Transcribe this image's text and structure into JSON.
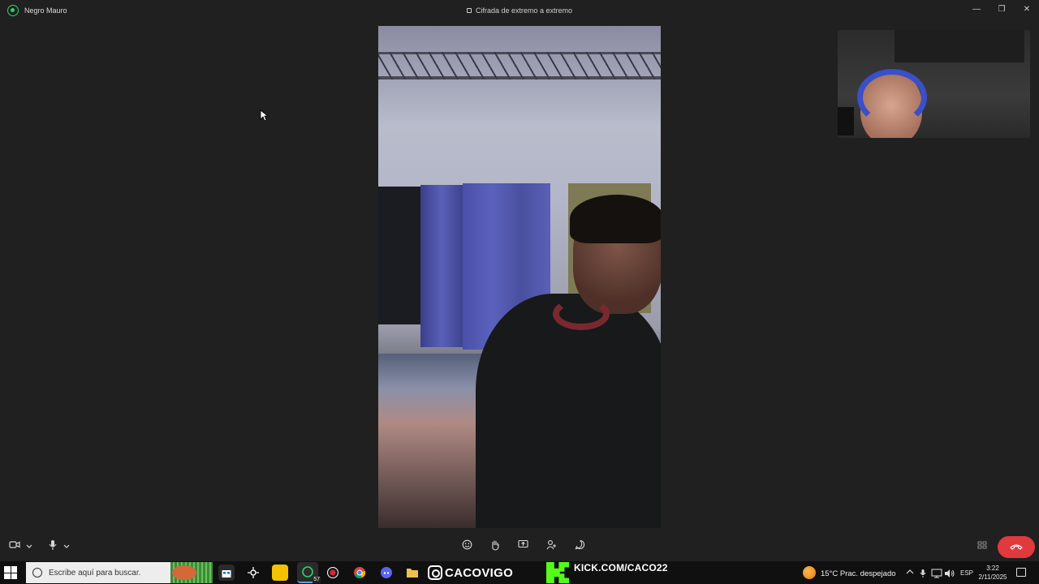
{
  "titlebar": {
    "contact_name": "Negro Mauro",
    "encryption_text": "Cifrada de extremo a extremo",
    "minimize": "—",
    "restore": "❐",
    "close": "✕"
  },
  "call_controls": {
    "video_icon": "video-camera-icon",
    "mic_icon": "microphone-icon",
    "center_icons": [
      "emoji-icon",
      "raise-hand-icon",
      "screen-share-icon",
      "add-person-icon",
      "chat-icon"
    ],
    "layout_icon": "grid-layout-icon",
    "end_call_icon": "hang-up-icon"
  },
  "taskbar": {
    "search_placeholder": "Escribe aquí para buscar.",
    "whatsapp_badge": "57",
    "caco_banner": "CACOVIGO",
    "kick_banner": "KICK.COM/CACO22",
    "weather": "15°C  Prac. despejado",
    "language": "ESP",
    "time": "3:22",
    "date": "2/11/2025"
  },
  "colors": {
    "background": "#202020",
    "end_call": "#e0393e",
    "whatsapp_green": "#2bd366",
    "kick_green": "#53fc18"
  }
}
